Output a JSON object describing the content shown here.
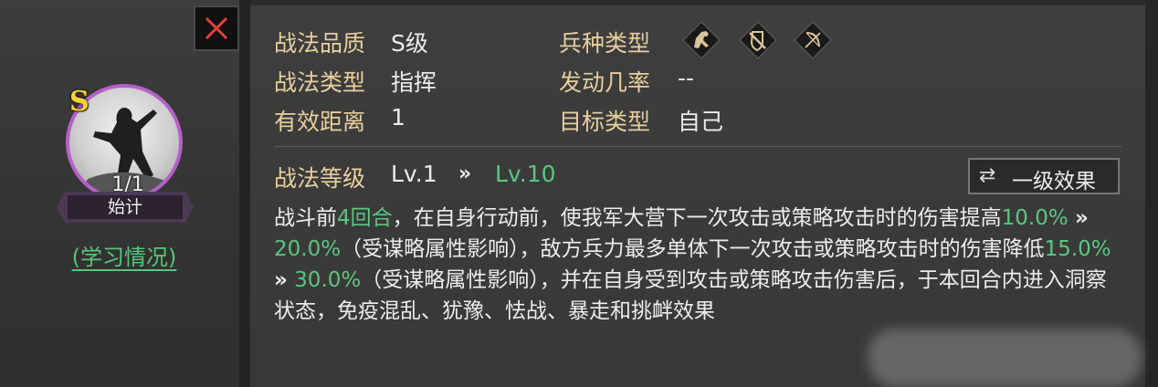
{
  "close_button": {
    "icon": "close-icon",
    "color": "#e5413c"
  },
  "tactic": {
    "grade_badge": "S",
    "level_progress": "1/1",
    "name": "始计",
    "learn_link": "(学习情况)"
  },
  "attributes": {
    "quality": {
      "label": "战法品质",
      "value": "S级"
    },
    "type": {
      "label": "战法类型",
      "value": "指挥"
    },
    "range": {
      "label": "有效距离",
      "value": "1"
    },
    "troop_type": {
      "label": "兵种类型",
      "icons": [
        "cavalry-icon",
        "shield-icon",
        "bow-icon"
      ]
    },
    "trigger_rate": {
      "label": "发动几率",
      "value": "--"
    },
    "target": {
      "label": "目标类型",
      "value": "自己"
    }
  },
  "level": {
    "label": "战法等级",
    "from": "Lv.1",
    "arrow": "»",
    "to": "Lv.10"
  },
  "effect_button": {
    "icon": "swap-icon",
    "label": "一级效果"
  },
  "description": {
    "p1": "战斗前",
    "rounds": "4回合",
    "p2": "，在自身行动前，使我军大营下一次攻击或策略攻击时的伤害提高",
    "v1_from": "10.0%",
    "arrow": "»",
    "v1_to": "20.0%",
    "p3": "（受谋略属性影响），敌方兵力最多单体下一次攻击或策略攻击时的伤害降低",
    "v2_from": "15.0%",
    "v2_to": "30.0%",
    "p4": "（受谋略属性影响），并在自身受到攻击或策略攻击伤害后，于本回合内进入洞察状态，免疫混乱、犹豫、怯战、暴走和挑衅效果"
  },
  "colors": {
    "label_gold": "#e8cf9e",
    "highlight_green": "#5cc67f",
    "avatar_ring": "#b560c8",
    "grade_gold": "#f5d23a"
  }
}
